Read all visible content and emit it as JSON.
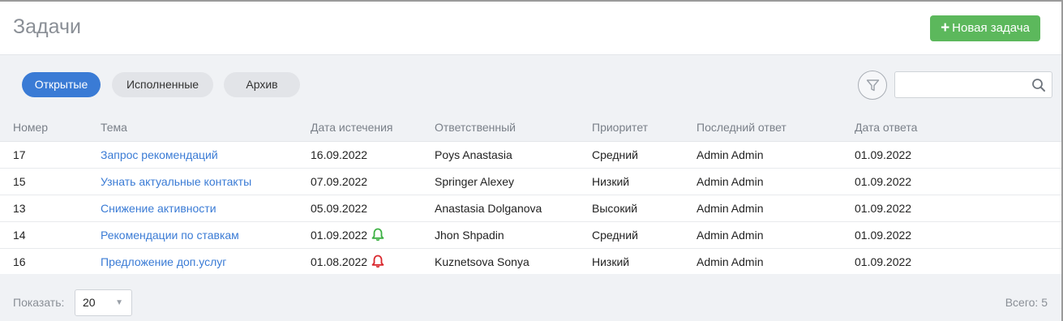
{
  "header": {
    "title": "Задачи",
    "new_task_label": "Новая задача",
    "new_task_plus": "+"
  },
  "tabs": [
    {
      "label": "Открытые",
      "active": true
    },
    {
      "label": "Исполненные",
      "active": false
    },
    {
      "label": "Архив",
      "active": false
    }
  ],
  "search": {
    "value": "",
    "placeholder": ""
  },
  "table": {
    "columns": [
      "Номер",
      "Тема",
      "Дата истечения",
      "Ответственный",
      "Приоритет",
      "Последний ответ",
      "Дата ответа"
    ],
    "rows": [
      {
        "num": "17",
        "topic": "Запрос рекомендаций",
        "due": "16.09.2022",
        "bell": null,
        "resp": "Poys Anastasia",
        "prio": "Средний",
        "last": "Admin Admin",
        "date": "01.09.2022"
      },
      {
        "num": "15",
        "topic": "Узнать актуальные контакты",
        "due": "07.09.2022",
        "bell": null,
        "resp": "Springer Alexey",
        "prio": "Низкий",
        "last": "Admin Admin",
        "date": "01.09.2022"
      },
      {
        "num": "13",
        "topic": "Снижение активности",
        "due": "05.09.2022",
        "bell": null,
        "resp": "Anastasia Dolganova",
        "prio": "Высокий",
        "last": "Admin Admin",
        "date": "01.09.2022"
      },
      {
        "num": "14",
        "topic": "Рекомендации по ставкам",
        "due": "01.09.2022",
        "bell": "green",
        "resp": "Jhon Shpadin",
        "prio": "Средний",
        "last": "Admin Admin",
        "date": "01.09.2022"
      },
      {
        "num": "16",
        "topic": "Предложение доп.услуг",
        "due": "01.08.2022",
        "bell": "red",
        "resp": "Kuznetsova Sonya",
        "prio": "Низкий",
        "last": "Admin Admin",
        "date": "01.09.2022"
      }
    ]
  },
  "footer": {
    "show_label": "Показать:",
    "per_page": "20",
    "total_label": "Всего:",
    "total_count": "5"
  },
  "colors": {
    "accent": "#3a7bd5",
    "success": "#5cb85c",
    "bell_green": "#3cb043",
    "bell_red": "#d9262c"
  }
}
